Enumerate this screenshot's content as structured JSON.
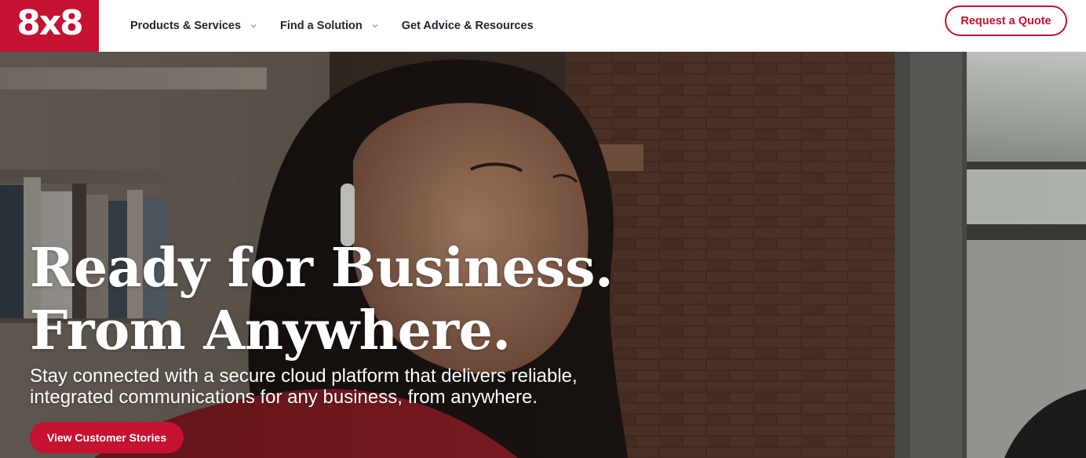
{
  "brand": {
    "logo_text": "8x8",
    "color": "#c41230"
  },
  "nav": {
    "items": [
      {
        "label": "Products & Services",
        "has_dropdown": true
      },
      {
        "label": "Find a Solution",
        "has_dropdown": true
      },
      {
        "label": "Get Advice & Resources",
        "has_dropdown": false
      }
    ],
    "quote_button": "Request a Quote"
  },
  "hero": {
    "headline_line1": "Ready for Business.",
    "headline_line2": "From Anywhere.",
    "subtext_line1": "Stay connected with a secure cloud platform that delivers reliable,",
    "subtext_line2": "integrated communications for any business, from anywhere.",
    "cta": "View Customer Stories",
    "image": "woman-with-earbud-smiling-brick-wall-background"
  }
}
